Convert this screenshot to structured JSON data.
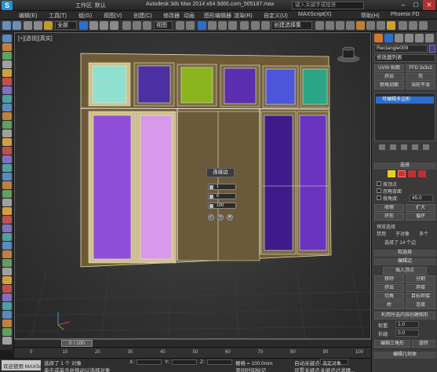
{
  "titlebar": {
    "workspace_label": "工作区: 默认",
    "app_title": "Autodesk 3ds Max  2014 x64    3d66.com_505187.max",
    "search_placeholder": "键入关键字或短语"
  },
  "menubar": {
    "items": [
      "编辑(E)",
      "工具(T)",
      "组(G)",
      "视图(V)",
      "创建(C)",
      "修改器",
      "动画",
      "图形编辑器",
      "渲染(R)",
      "自定义(U)",
      "MAXScript(X)",
      "帮助(H)",
      "Phoenix FD"
    ]
  },
  "toolbar": {
    "filter_value": "全部",
    "named_selection_placeholder": "创建选择集"
  },
  "viewport": {
    "label": "[+][透视][真实]"
  },
  "caddy": {
    "title": "连接边",
    "segments": "1",
    "pinch": "0",
    "slide": "100"
  },
  "right_panel": {
    "object_name": "Rectangle009",
    "modifier_list": "修改器列表",
    "btn_uvw_map": "UVW 贴图",
    "btn_ffd": "FFD 3x3x3",
    "btn_extrude": "挤出",
    "btn_shell": "壳",
    "btn_bevel_profile": "倒角剖面",
    "btn_turbosmooth": "涡轮平滑",
    "stack_item": "可编辑多边形",
    "selection_header": "选择",
    "chk_by_vertex": "按顶点",
    "chk_ignore_backface": "忽略背面",
    "chk_by_angle": "按角度:",
    "angle_value": "45.0",
    "btn_shrink": "收缩",
    "btn_grow": "扩大",
    "btn_ring": "环形",
    "btn_loop": "循环",
    "preview_header": "预览选择",
    "radio_off": "禁用",
    "radio_subobject": "子对象",
    "radio_multi": "多个",
    "selected_count": "选择了 14 个边",
    "soft_selection_header": "软选择",
    "edit_edges_header": "编辑边",
    "insert_vertex": "插入顶点",
    "btn_remove": "移除",
    "btn_split": "分割",
    "btn_extrude2": "挤出",
    "btn_weld": "焊接",
    "btn_chamfer": "切角",
    "btn_target_weld": "目标焊接",
    "btn_bridge": "桥",
    "btn_connect": "连接",
    "btn_create_shape": "利用所选内容创建图形",
    "weight_label": "权重:",
    "weight_value": "1.0",
    "crease_label": "折缝:",
    "crease_value": "0.0",
    "btn_edit_tri": "编辑三角形",
    "btn_rotate": "旋转",
    "edit_geometry_header": "编辑几何体"
  },
  "timeline": {
    "frame_counter": "0 / 100"
  },
  "trackbar": {
    "ticks": [
      "0",
      "10",
      "20",
      "30",
      "40",
      "50",
      "60",
      "70",
      "80",
      "90",
      "100"
    ]
  },
  "status": {
    "welcome": "欢迎使用 MAXSc",
    "selection_msg": "选择了 1 个 对象",
    "hint_msg": "单击或单击并拖动以选择对象",
    "x_label": "X:",
    "y_label": "Y:",
    "z_label": "Z:",
    "grid_label": "栅格 = 100.0mm",
    "add_time_tag": "添加时间标记",
    "auto_key": "自动关键点",
    "selected_objects": "选定对象",
    "set_key": "设置关键点",
    "key_filters": "关键点过滤器..."
  },
  "colors": {
    "accent_selected": "#2a6fd0",
    "panel_top_1": "#8fe0d0",
    "panel_top_2": "#4c2fa0",
    "panel_top_3": "#8ab41e",
    "panel_top_4": "#5b2fb0",
    "panel_top_5": "#4d55d8",
    "panel_top_6": "#2aa585",
    "panel_low_1": "#8f4fd6",
    "panel_low_2": "#d69ae8",
    "panel_brown": "#6b5a3a",
    "panel_low_5": "#3e1a8a",
    "panel_low_6": "#6a34c2"
  }
}
